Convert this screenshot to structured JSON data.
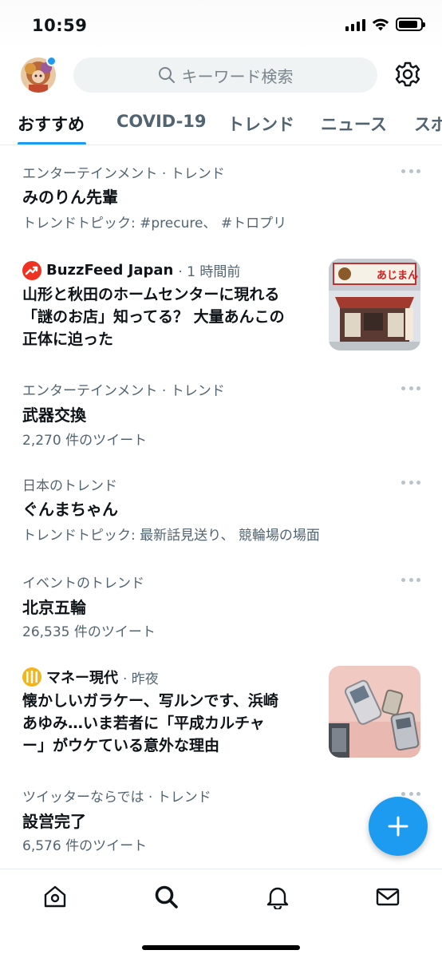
{
  "status_bar": {
    "time": "10:59",
    "signal_bars": 4,
    "battery_level": 0.9,
    "icons": [
      "signal-icon",
      "wifi-icon",
      "battery-icon"
    ]
  },
  "header": {
    "avatar_icon": "profile-avatar",
    "search_placeholder": "キーワード検索",
    "settings_icon": "gear-icon"
  },
  "tabs": [
    {
      "label": "おすすめ",
      "active": true
    },
    {
      "label": "COVID-19",
      "active": false
    },
    {
      "label": "トレンド",
      "active": false
    },
    {
      "label": "ニュース",
      "active": false
    },
    {
      "label": "スポ",
      "active": false
    }
  ],
  "feed": [
    {
      "type": "trend",
      "category": "エンターテインメント · トレンド",
      "title": "みのりん先輩",
      "sub": "トレンドトピック: #precure、 #トロプリ"
    },
    {
      "type": "news",
      "source": "BuzzFeed Japan",
      "time": "· 1 時間前",
      "title": [
        "山形と秋田のホームセンターに現れる",
        "「謎のお店」知ってる？ 大量あんこの",
        "正体に迫った"
      ],
      "thumb_sign": "あじまん"
    },
    {
      "type": "trend",
      "category": "エンターテインメント · トレンド",
      "title": "武器交換",
      "sub": "2,270 件のツイート"
    },
    {
      "type": "trend",
      "category": "日本のトレンド",
      "title": "ぐんまちゃん",
      "sub": "トレンドトピック: 最新話見送り、 競輪場の場面"
    },
    {
      "type": "trend",
      "category": "イベントのトレンド",
      "title": "北京五輪",
      "sub": "26,535 件のツイート"
    },
    {
      "type": "news",
      "source": "マネー現代",
      "time": "· 昨夜",
      "title": [
        "懐かしいガラケー、写ルンです、浜崎",
        "あゆみ…いま若者に「平成カルチャ",
        "ー」がウケている意外な理由"
      ]
    },
    {
      "type": "trend",
      "category": "ツイッターならでは · トレンド",
      "title": "設営完了",
      "sub": "6,576 件のツイート"
    }
  ],
  "fab": {
    "icon": "plus-icon"
  },
  "bottom_nav": [
    "home-icon",
    "search-icon",
    "bell-icon",
    "mail-icon"
  ],
  "colors": {
    "accent": "#1d9bf0",
    "secondary_text": "#536471",
    "primary_text": "#0f1419"
  }
}
